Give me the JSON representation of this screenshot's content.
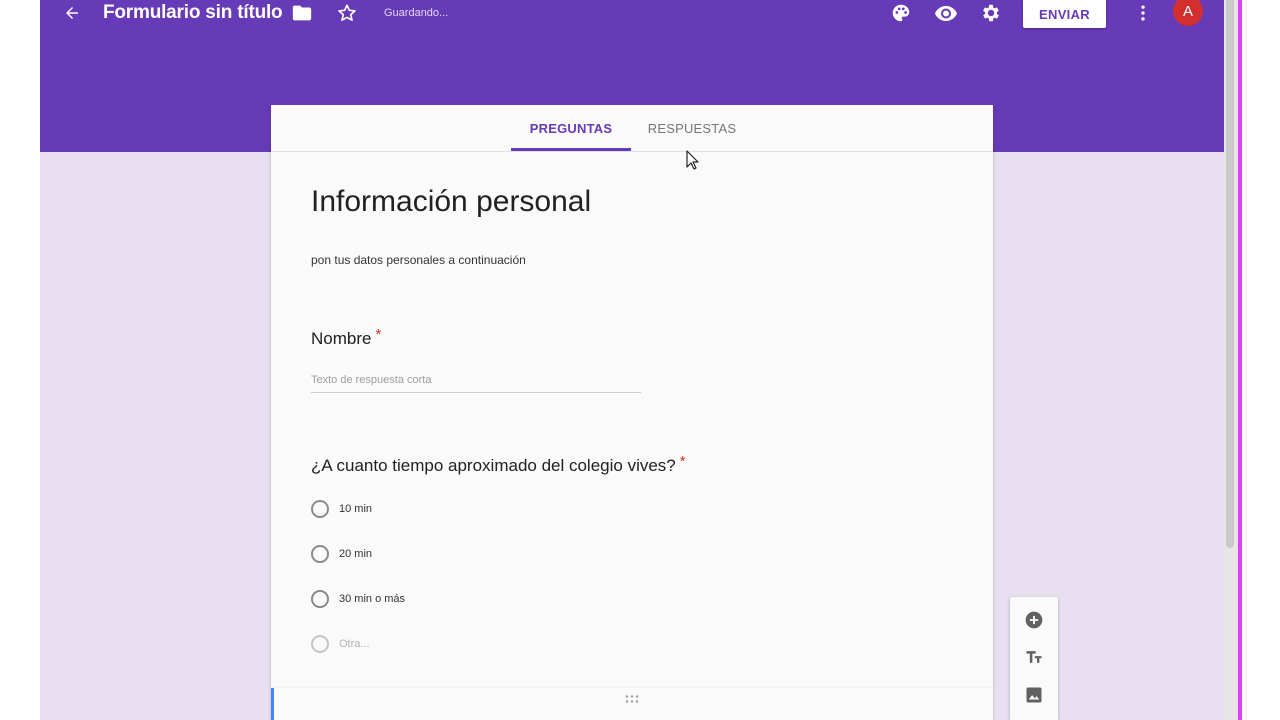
{
  "header": {
    "title": "Formulario sin título",
    "status": "Guardando...",
    "send_label": "ENVIAR",
    "avatar_letter": "A",
    "icons": [
      "back-icon",
      "folder-icon",
      "star-icon",
      "palette-icon",
      "eye-icon",
      "gear-icon",
      "more-icon"
    ]
  },
  "tabs": [
    {
      "label": "PREGUNTAS",
      "active": true
    },
    {
      "label": "RESPUESTAS",
      "active": false
    }
  ],
  "section": {
    "title": "Información personal",
    "description": "pon tus datos personales a continuación"
  },
  "questions": [
    {
      "title": "Nombre",
      "required": true,
      "type": "short-answer",
      "placeholder": "Texto de respuesta corta"
    },
    {
      "title": "¿A cuanto tiempo aproximado del colegio vives?",
      "required": true,
      "type": "multiple-choice",
      "options": [
        "10 min",
        "20 min",
        "30 min o más"
      ],
      "other_label": "Otra..."
    }
  ],
  "required_mark": "*",
  "side_toolbar": [
    "add-question-icon",
    "add-title-icon",
    "add-image-icon"
  ],
  "colors": {
    "theme": "#673ab7",
    "background": "#e8dff0",
    "required": "#d93025",
    "avatar": "#d32f2f"
  }
}
